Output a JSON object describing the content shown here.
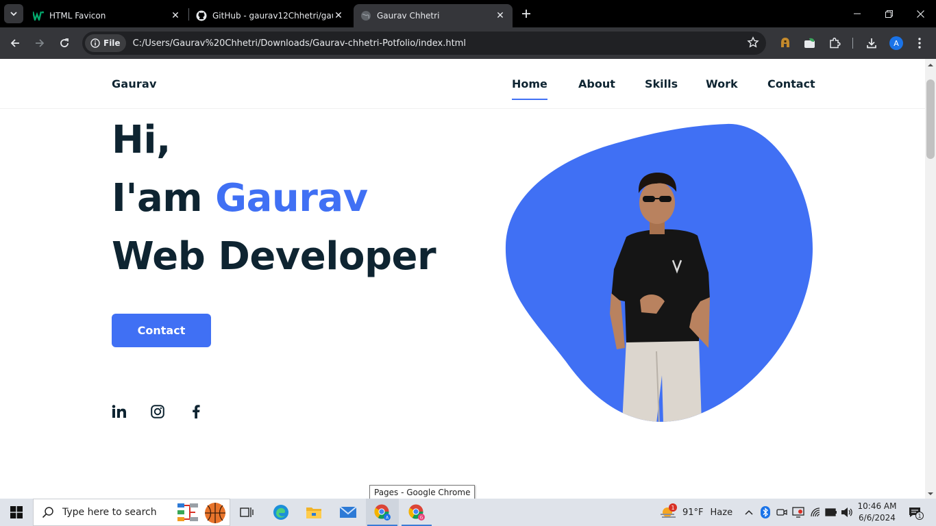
{
  "browser": {
    "tabs": [
      {
        "title": "HTML Favicon",
        "active": false
      },
      {
        "title": "GitHub - gaurav12Chhetri/gaura",
        "active": false
      },
      {
        "title": "Gaurav Chhetri",
        "active": true
      }
    ],
    "address": {
      "scheme_label": "File",
      "url": "C:/Users/Gaurav%20Chhetri/Downloads/Gaurav-chhetri-Potfolio/index.html"
    },
    "profile_initial": "A"
  },
  "page": {
    "logo": "Gaurav",
    "nav": [
      "Home",
      "About",
      "Skills",
      "Work",
      "Contact"
    ],
    "active_nav": "Home",
    "hero": {
      "line1": "Hi,",
      "line2_prefix": "I'am ",
      "line2_name": "Gaurav",
      "line3": "Web Developer"
    },
    "contact_button": "Contact",
    "socials": [
      "linkedin-icon",
      "instagram-icon",
      "facebook-icon"
    ],
    "colors": {
      "accent": "#4070f4",
      "text": "#0e2431"
    }
  },
  "tooltip": "Pages - Google Chrome",
  "taskbar": {
    "search_placeholder": "Type here to search",
    "weather": {
      "temp": "91°F",
      "condition": "Haze",
      "badge": "1"
    },
    "time": "10:46 AM",
    "date": "6/6/2024",
    "notification_count": "1"
  }
}
